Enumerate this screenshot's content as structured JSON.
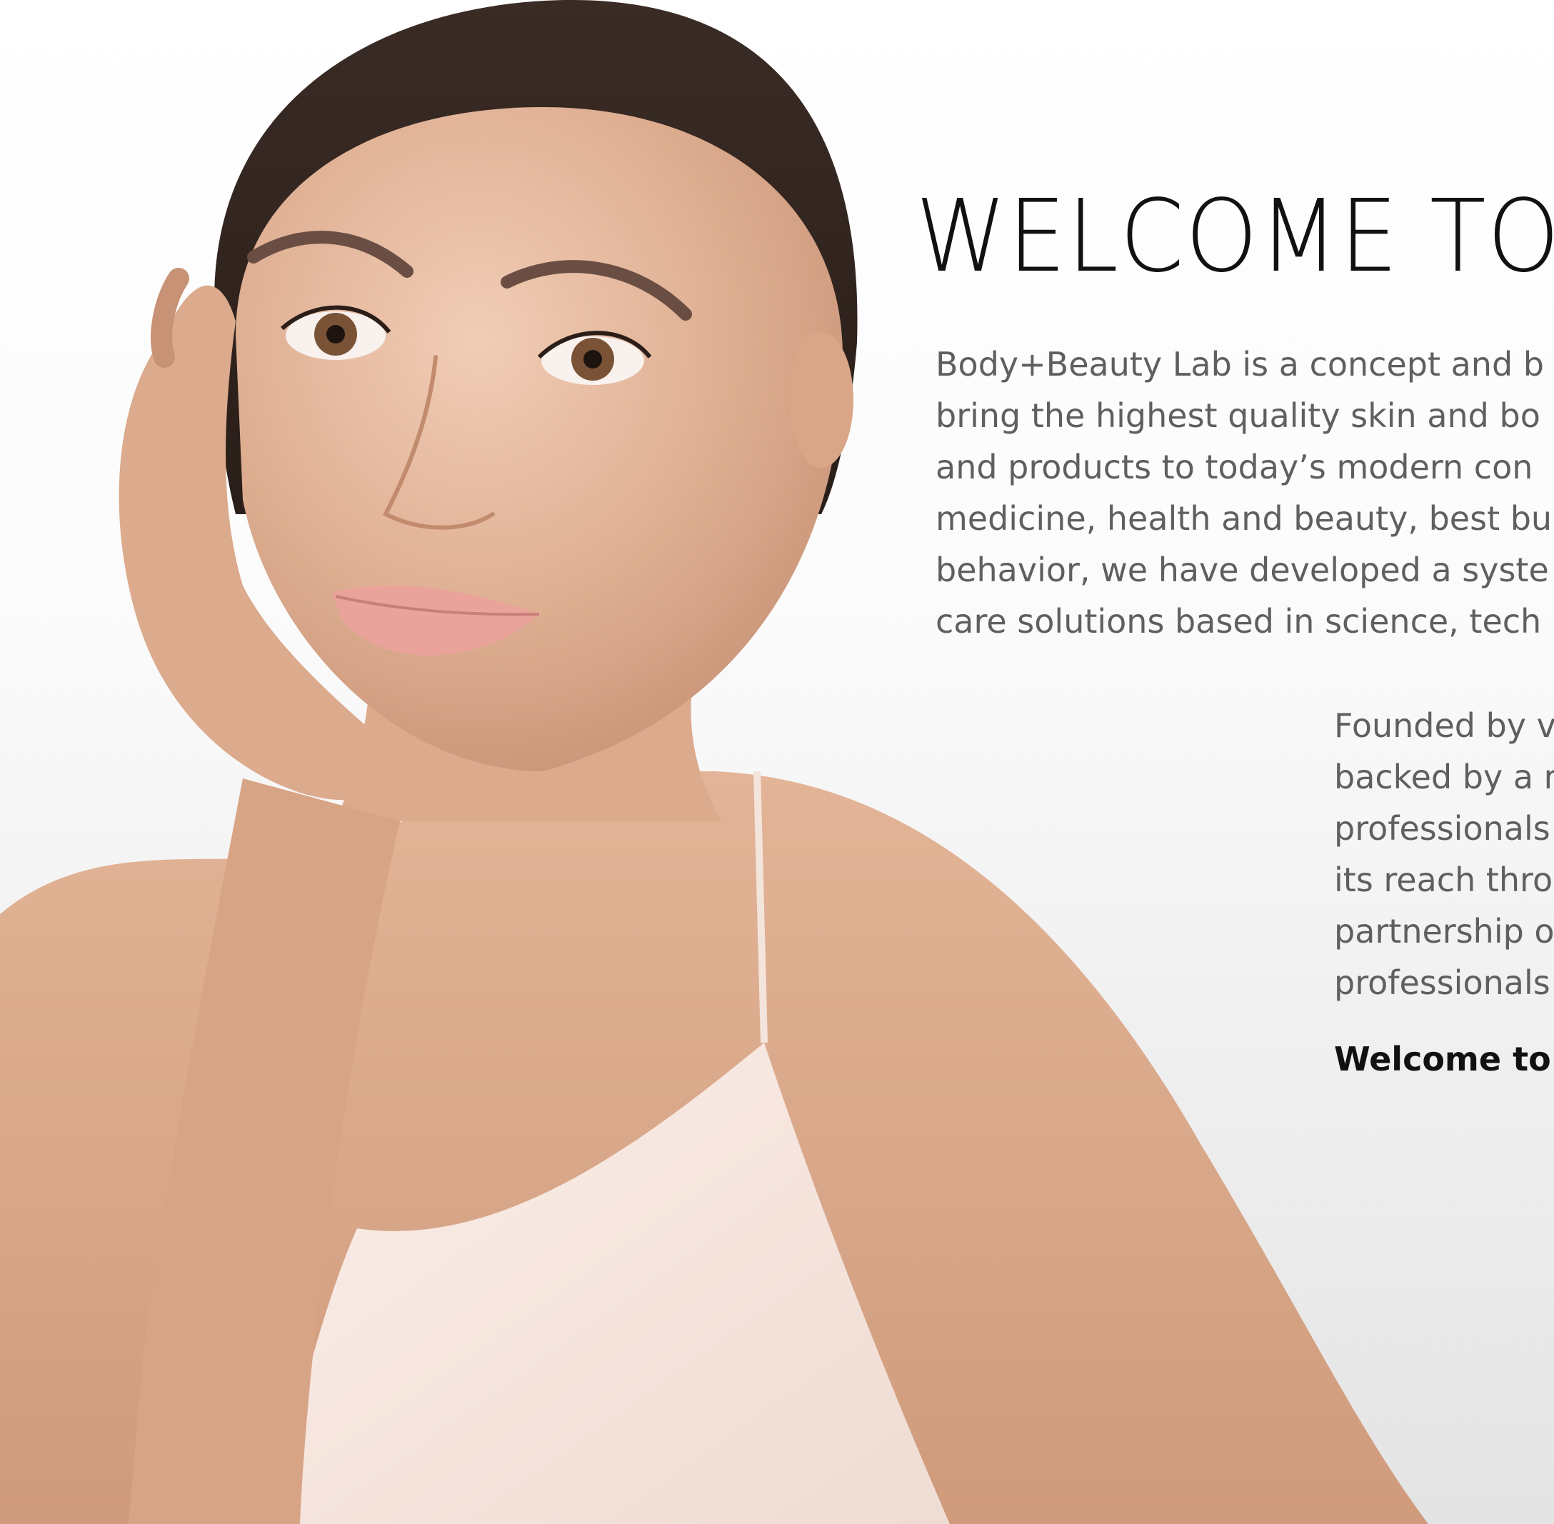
{
  "heading": "WELCOME TO",
  "intro_lines": [
    "Body+Beauty Lab is a concept and b",
    "bring the highest quality skin and bo",
    "and products to today’s modern con",
    "medicine, health and beauty, best bu",
    "behavior, we have developed a syste",
    "care solutions based in science, tech"
  ],
  "founded_lines": [
    "Founded by v",
    "backed by a r",
    "professionals",
    "its reach thro",
    "partnership o",
    "professionals"
  ],
  "closing": "Welcome to t",
  "colors": {
    "heading": "#111111",
    "body_text": "#5f5f5f",
    "background_top": "#ffffff",
    "background_bottom": "#e4e4e4"
  }
}
